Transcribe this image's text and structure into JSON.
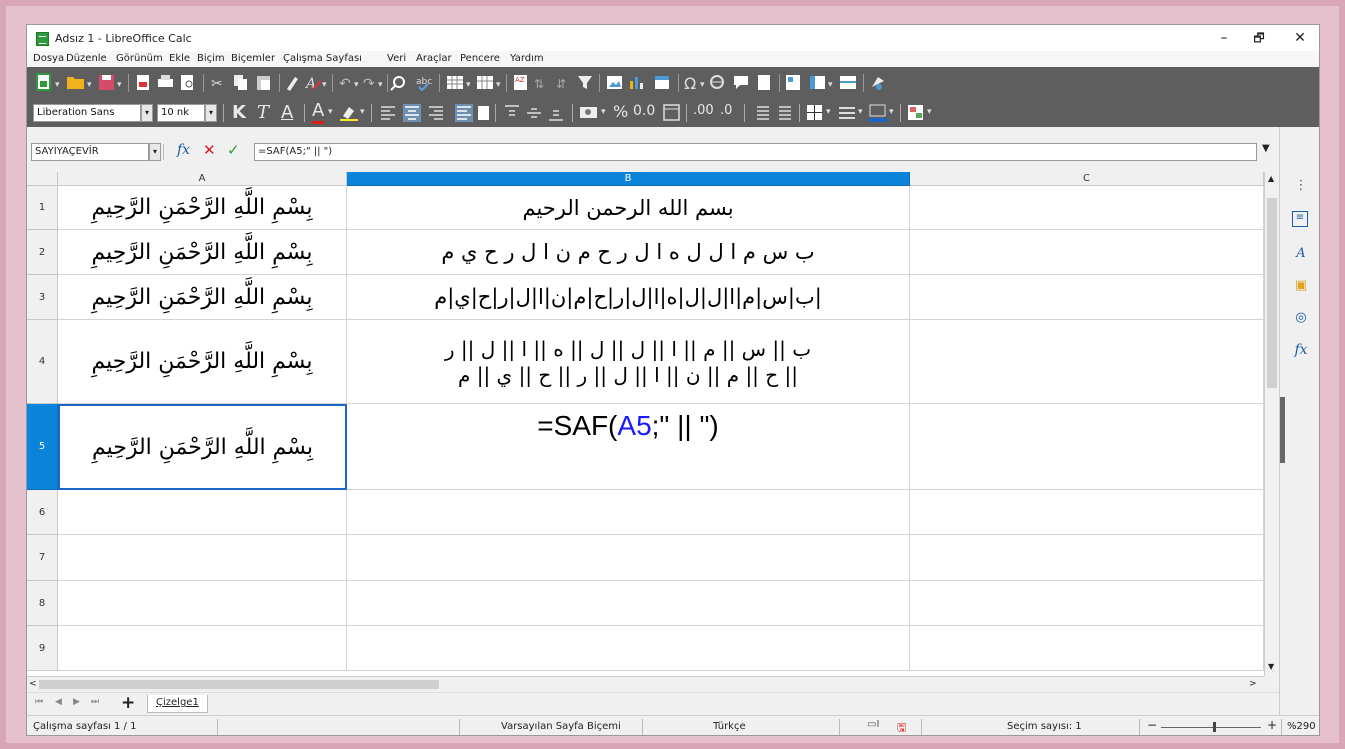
{
  "window": {
    "title": "Adsız 1 - LibreOffice Calc",
    "minimize": "–",
    "restore": "🗗",
    "close": "✕"
  },
  "menu": [
    "Dosya",
    "Düzenle",
    "Görünüm",
    "Ekle",
    "Biçim",
    "Biçemler",
    "Çalışma Sayfası",
    "Veri",
    "Araçlar",
    "Pencere",
    "Yardım"
  ],
  "toolbar2": {
    "font_name": "Liberation Sans",
    "font_size": "10 nk",
    "bold": "K",
    "italic": "T",
    "underline": "A",
    "font_color_letter": "A",
    "percent": "%",
    "number_format": "0.0",
    "decimal_add": ".00",
    "decimal_remove": ".0"
  },
  "formula_bar": {
    "name_box": "SAYIYAÇEVİR",
    "fx": "fx",
    "cancel": "✕",
    "accept": "✓",
    "input": "=SAF(A5;\" || \")"
  },
  "grid": {
    "columns": [
      "A",
      "B",
      "C"
    ],
    "rows": [
      {
        "n": "1",
        "a": "بِسْمِ اللَّهِ الرَّحْمَنِ الرَّحِيمِ",
        "b": "بسم الله الرحمن الرحيم"
      },
      {
        "n": "2",
        "a": "بِسْمِ اللَّهِ الرَّحْمَنِ الرَّحِيمِ",
        "b": "ب س م ا ل ل ه ا ل ر ح م ن ا ل ر ح ي م"
      },
      {
        "n": "3",
        "a": "بِسْمِ اللَّهِ الرَّحْمَنِ الرَّحِيمِ",
        "b": "|ب|س|م|ا|ل|ل|ه|ا|ل|ر|ح|م|ن|ا|ل|ر|ح|ي|م"
      },
      {
        "n": "4",
        "a": "بِسْمِ اللَّهِ الرَّحْمَنِ الرَّحِيمِ",
        "b1": "ب || س || م || ا || ل || ل || ه || ا || ل || ر",
        "b2": "|| ح || م || ن || ا || ل || ر || ح || ي || م"
      },
      {
        "n": "5",
        "a": "بِسْمِ اللَّهِ الرَّحْمَنِ الرَّحِيمِ",
        "b_pre": "=SAF(",
        "b_ref": "A5",
        "b_post": ";\" || \")"
      },
      {
        "n": "6"
      },
      {
        "n": "7"
      },
      {
        "n": "8"
      },
      {
        "n": "9"
      }
    ]
  },
  "sheet_tab": "Çizelge1",
  "status": {
    "sheet": "Çalışma sayfası 1 / 1",
    "page_style": "Varsayılan Sayfa Biçemi",
    "language": "Türkçe",
    "selection": "Seçim sayısı: 1",
    "zoom": "%290"
  },
  "colors": {
    "accent": "#0a84d8",
    "toolbar_bg": "#5e5e5e",
    "frame": "#e5c1cd",
    "ref_blue": "#1a1aff"
  }
}
